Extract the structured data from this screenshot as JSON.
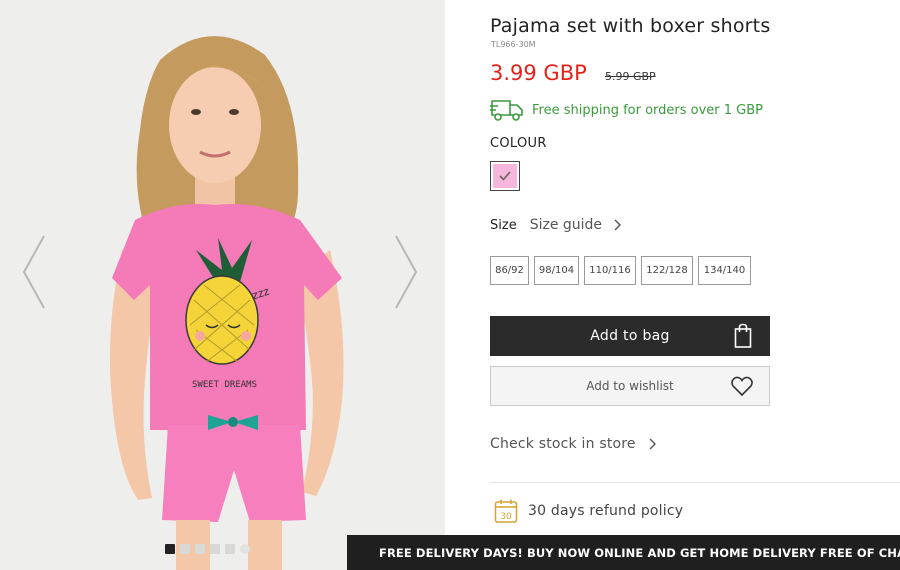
{
  "product": {
    "title": "Pajama set with boxer shorts",
    "sku": "TL966-30M",
    "price": "3.99 GBP",
    "old_price": "5.99 GBP",
    "shipping_text": "Free shipping for orders over 1 GBP",
    "shipping_color": "#3b9a3b",
    "price_color": "#e2231a"
  },
  "colour": {
    "label": "COLOUR",
    "selected_swatch": "#f7b6dc"
  },
  "size": {
    "label": "Size",
    "guide_label": "Size guide",
    "options": [
      "86/92",
      "98/104",
      "110/116",
      "122/128",
      "134/140"
    ]
  },
  "actions": {
    "add_to_bag": "Add to bag",
    "add_to_wishlist": "Add to wishlist",
    "check_stock": "Check stock in store"
  },
  "refund": {
    "days_icon_number": "30",
    "text": "30 days refund policy"
  },
  "tshirt_print": {
    "text": "SWEET DREAMS",
    "zzz": "zzz"
  },
  "banner": {
    "text": "FREE DELIVERY DAYS! BUY NOW ONLINE AND GET HOME DELIVERY FREE OF CHARGE!"
  },
  "gallery": {
    "image_count": 6,
    "active_index": 0
  }
}
